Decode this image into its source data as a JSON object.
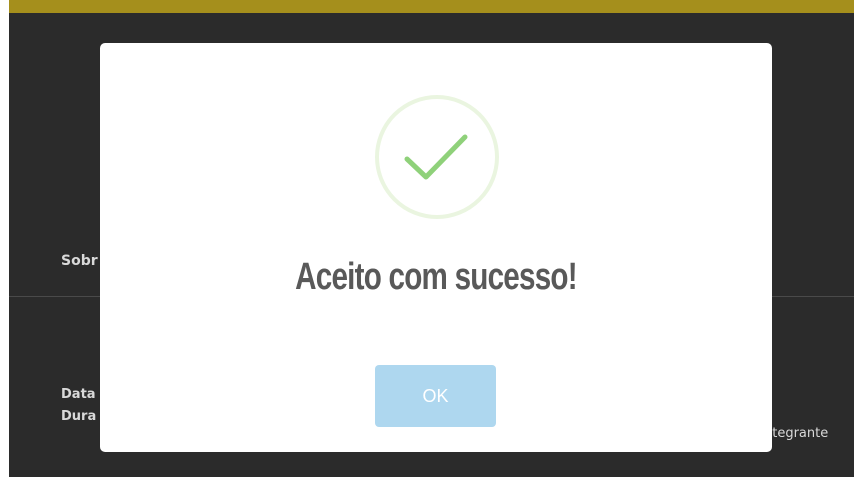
{
  "background": {
    "section_heading": "Sobr",
    "detail_lines": [
      "Data",
      "Dura"
    ],
    "side_text": "ntegrante"
  },
  "modal": {
    "title": "Aceito com sucesso!",
    "confirm_label": "OK",
    "icon": "check-icon"
  },
  "colors": {
    "top_accent": "#a58f1c",
    "backdrop": "#2b2b2b",
    "success_green": "#8fd17a",
    "button": "#aed7ef"
  }
}
